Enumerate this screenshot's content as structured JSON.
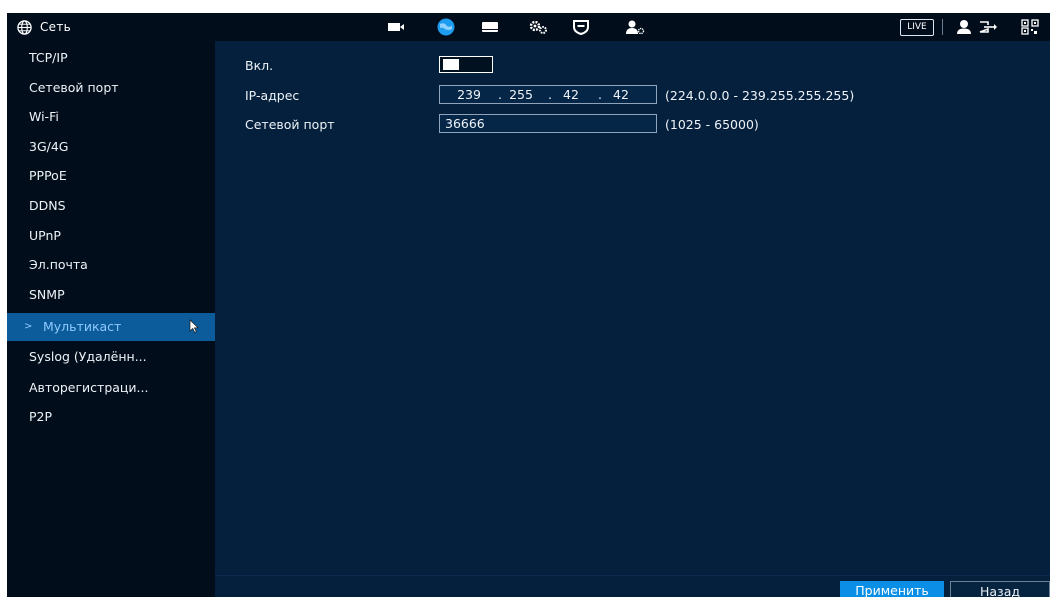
{
  "header": {
    "title": "Сеть",
    "live_label": "LIVE",
    "icons": [
      "globe-icon",
      "camera-icon",
      "network-icon",
      "storage-icon",
      "settings-icon",
      "shield-icon",
      "account-icon",
      "user-icon",
      "logout-icon",
      "qr-icon"
    ]
  },
  "sidebar": {
    "items": [
      {
        "label": "TCP/IP"
      },
      {
        "label": "Сетевой порт"
      },
      {
        "label": "Wi-Fi"
      },
      {
        "label": "3G/4G"
      },
      {
        "label": "PPPoE"
      },
      {
        "label": "DDNS"
      },
      {
        "label": "UPnP"
      },
      {
        "label": "Эл.почта"
      },
      {
        "label": "SNMP"
      },
      {
        "label": "Мультикаст"
      },
      {
        "label": "Syslog (Удалённ..."
      },
      {
        "label": "Авторегистраци..."
      },
      {
        "label": "P2P"
      }
    ],
    "active_index": 9,
    "active_marker": ">"
  },
  "form": {
    "enable_label": "Вкл.",
    "enable_on": true,
    "ip_label": "IP-адрес",
    "ip": {
      "a": "239",
      "b": "255",
      "c": "42",
      "d": "42",
      "sep": "."
    },
    "ip_range": "(224.0.0.0 - 239.255.255.255)",
    "port_label": "Сетевой порт",
    "port_value": "36666",
    "port_range": "(1025 - 65000)"
  },
  "footer": {
    "apply_label": "Применить",
    "back_label": "Назад"
  },
  "colors": {
    "background": "#04203d",
    "sidebar": "#020d1b",
    "active": "#0c5b9a",
    "accent": "#0b8fe6"
  }
}
